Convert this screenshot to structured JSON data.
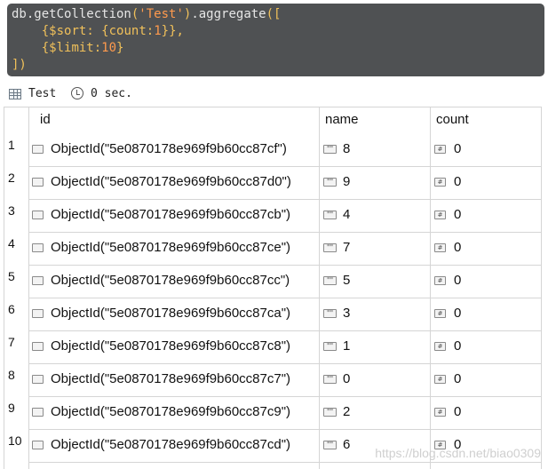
{
  "editor": {
    "lines": [
      [
        {
          "t": "db.getCollection",
          "c": "c-fn"
        },
        {
          "t": "(",
          "c": "c-br"
        },
        {
          "t": "'Test'",
          "c": "c-str"
        },
        {
          "t": ")",
          "c": "c-br"
        },
        {
          "t": ".aggregate",
          "c": "c-fn"
        },
        {
          "t": "([",
          "c": "c-br"
        }
      ],
      [
        {
          "t": "    ",
          "c": "c-fn"
        },
        {
          "t": "{",
          "c": "c-pun"
        },
        {
          "t": "$sort",
          "c": "c-key"
        },
        {
          "t": ": ",
          "c": "c-pun"
        },
        {
          "t": "{",
          "c": "c-pun"
        },
        {
          "t": "count",
          "c": "c-key"
        },
        {
          "t": ":",
          "c": "c-pun"
        },
        {
          "t": "1",
          "c": "c-num"
        },
        {
          "t": "}},",
          "c": "c-pun"
        }
      ],
      [
        {
          "t": "    ",
          "c": "c-fn"
        },
        {
          "t": "{",
          "c": "c-pun"
        },
        {
          "t": "$limit",
          "c": "c-key"
        },
        {
          "t": ":",
          "c": "c-pun"
        },
        {
          "t": "10",
          "c": "c-num"
        },
        {
          "t": "}",
          "c": "c-pun"
        }
      ],
      [
        {
          "t": "])",
          "c": "c-br"
        }
      ]
    ]
  },
  "status": {
    "collection": "Test",
    "time": "0 sec."
  },
  "table": {
    "columns": [
      "id",
      "name",
      "count"
    ],
    "rows": [
      {
        "n": "1",
        "id": "ObjectId(\"5e0870178e969f9b60cc87cf\")",
        "name": "8",
        "count": "0"
      },
      {
        "n": "2",
        "id": "ObjectId(\"5e0870178e969f9b60cc87d0\")",
        "name": "9",
        "count": "0"
      },
      {
        "n": "3",
        "id": "ObjectId(\"5e0870178e969f9b60cc87cb\")",
        "name": "4",
        "count": "0"
      },
      {
        "n": "4",
        "id": "ObjectId(\"5e0870178e969f9b60cc87ce\")",
        "name": "7",
        "count": "0"
      },
      {
        "n": "5",
        "id": "ObjectId(\"5e0870178e969f9b60cc87cc\")",
        "name": "5",
        "count": "0"
      },
      {
        "n": "6",
        "id": "ObjectId(\"5e0870178e969f9b60cc87ca\")",
        "name": "3",
        "count": "0"
      },
      {
        "n": "7",
        "id": "ObjectId(\"5e0870178e969f9b60cc87c8\")",
        "name": "1",
        "count": "0"
      },
      {
        "n": "8",
        "id": "ObjectId(\"5e0870178e969f9b60cc87c7\")",
        "name": "0",
        "count": "0"
      },
      {
        "n": "9",
        "id": "ObjectId(\"5e0870178e969f9b60cc87c9\")",
        "name": "2",
        "count": "0"
      },
      {
        "n": "10",
        "id": "ObjectId(\"5e0870178e969f9b60cc87cd\")",
        "name": "6",
        "count": "0"
      }
    ]
  },
  "watermark": "https://blog.csdn.net/biao0309",
  "icons": {
    "status_table": "table-icon",
    "status_time": "clock-icon",
    "id_type": "objectid-icon",
    "name_type": "string-icon",
    "count_type": "number-icon"
  },
  "colors": {
    "editor_bg": "#4f5153",
    "string": "#ff9a4d",
    "keyword": "#f0c05a"
  }
}
